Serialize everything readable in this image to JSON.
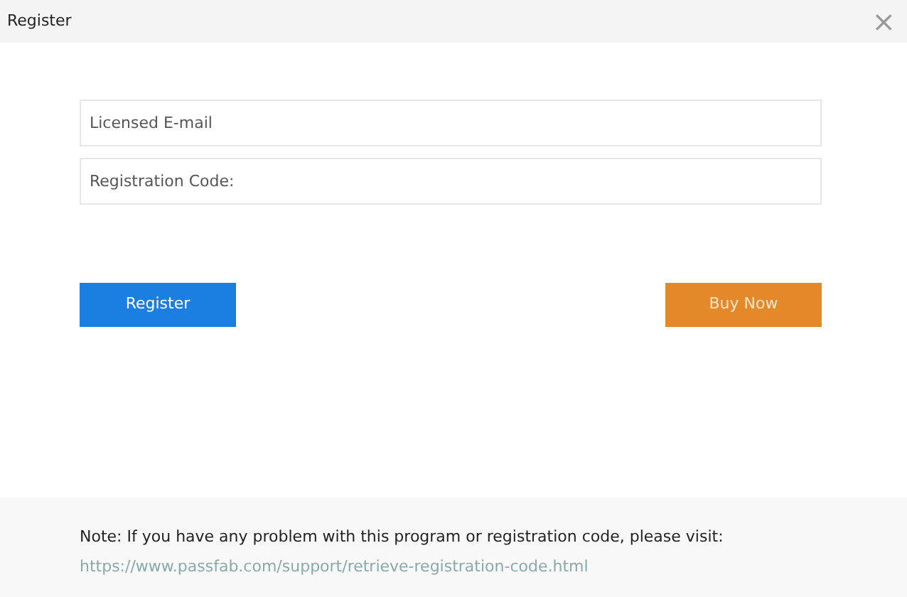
{
  "window": {
    "title": "Register",
    "close": "×"
  },
  "fields": [
    {
      "placeholder": "Licensed E-mail"
    },
    {
      "placeholder": "Registration Code:"
    }
  ],
  "buttons": [
    {
      "label": "Register",
      "kind": "primary"
    },
    {
      "label": "Buy Now",
      "kind": "buy"
    }
  ],
  "footer": {
    "note": "Note: If you have any problem with this program or registration code, please visit:",
    "link": "https://www.passfab.com/support/retrieve-registration-code.html"
  }
}
